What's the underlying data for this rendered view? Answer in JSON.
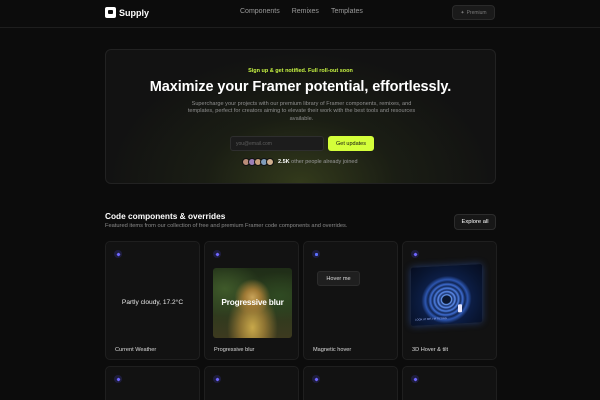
{
  "header": {
    "logo_text": "Supply",
    "nav": [
      "Components",
      "Remixes",
      "Templates"
    ],
    "premium_label": "Premium"
  },
  "hero": {
    "eyebrow": "Sign up & get notified. Full roll-out soon",
    "title": "Maximize your Framer potential, effortlessly.",
    "description": "Supercharge your projects with our premium library of Framer components, remixes, and templates, perfect for creators aiming to elevate their work with the best tools and resources available.",
    "email_placeholder": "you@email.com",
    "cta_label": "Get updates",
    "joined_count": "2.5K",
    "joined_text": "other people already joined",
    "avatar_colors": [
      "#b98c78",
      "#9c7fb8",
      "#c9a07d",
      "#7f9cba",
      "#d0b090"
    ]
  },
  "section": {
    "title": "Code components & overrides",
    "subtitle": "Featured items from our collection of free and premium Framer code components and overrides.",
    "explore_label": "Explore all"
  },
  "cards": [
    {
      "label": "Current Weather",
      "preview_text": "Partly cloudy, 17.2°C"
    },
    {
      "label": "Progressive blur",
      "preview_text": "Progressive blur"
    },
    {
      "label": "Magnetic hover",
      "preview_text": "Hover me"
    },
    {
      "label": "3D Hover & tilt",
      "preview_text": "LOOK AT ME, I'M TILTING"
    }
  ],
  "colors": {
    "accent": "#d4ff3a",
    "background": "#0c0c0c",
    "badge": "#6f66ff"
  }
}
